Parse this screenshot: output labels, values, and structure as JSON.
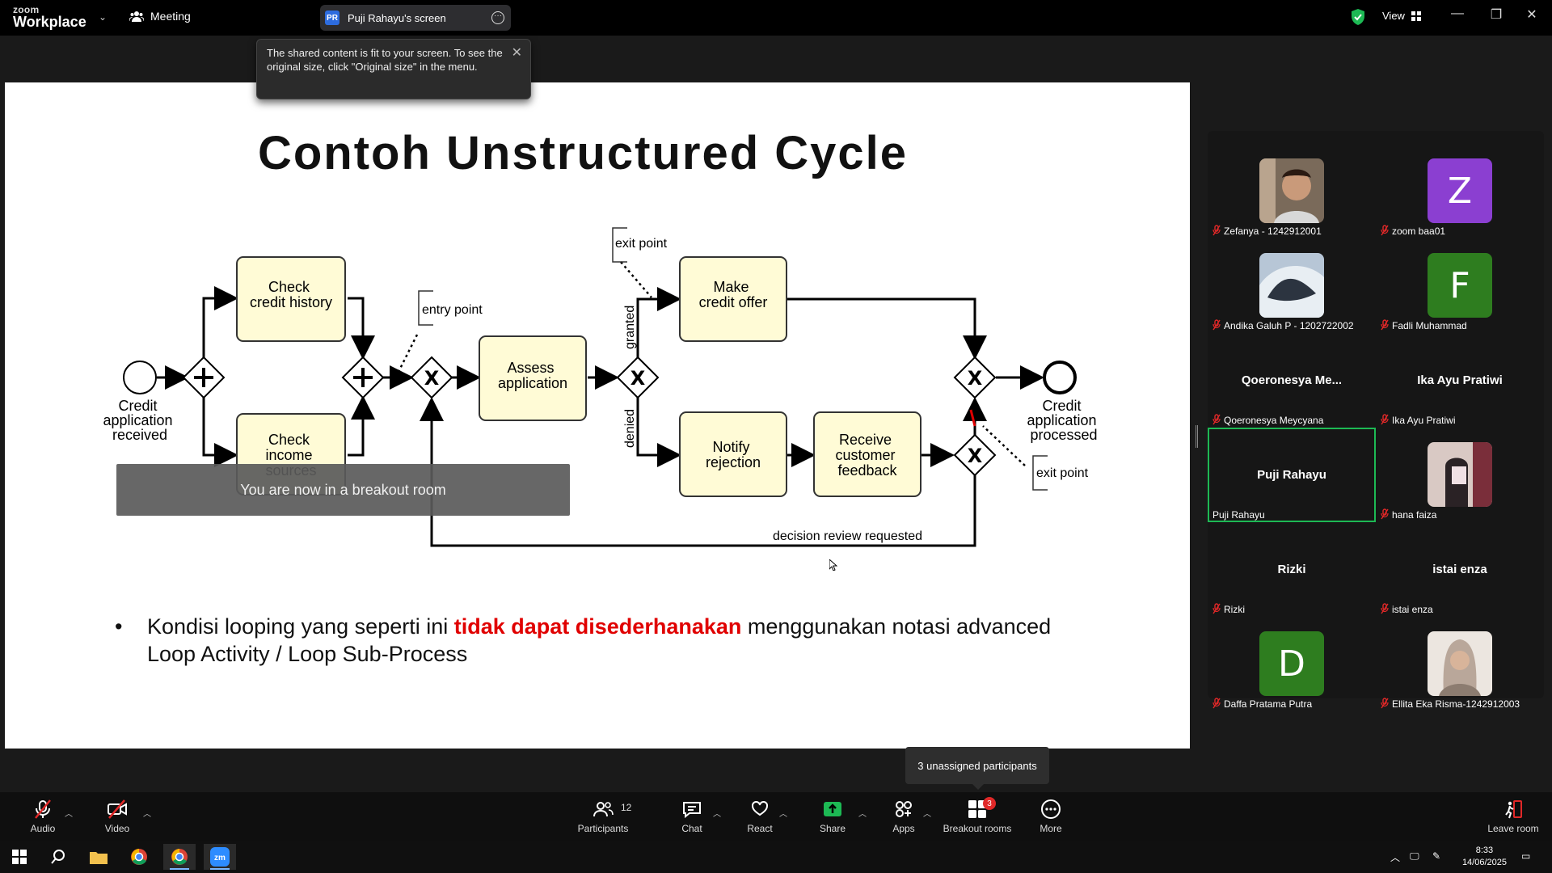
{
  "app": {
    "logo_line1": "zoom",
    "logo_line2": "Workplace",
    "meeting_label": "Meeting",
    "share_owner_initials": "PR",
    "share_label": "Puji Rahayu's screen",
    "view_label": "View"
  },
  "tooltip": {
    "text": "The shared content is fit to your screen. To see the original size, click \"Original size\" in the menu."
  },
  "slide": {
    "title": "Contoh Unstructured Cycle",
    "breakout_banner": "You are now in a breakout room",
    "bullet_prefix": "Kondisi looping yang seperti ini ",
    "bullet_highlight": "tidak dapat disederhanakan",
    "bullet_suffix": " menggunakan notasi advanced Loop Activity / Loop Sub-Process",
    "diagram": {
      "start_label": [
        "Credit",
        "application",
        "received"
      ],
      "check_credit": [
        "Check",
        "credit history"
      ],
      "check_income": [
        "Check",
        "income",
        "sources"
      ],
      "entry_point": "entry point",
      "assess": [
        "Assess",
        "application"
      ],
      "exit_point_top": "exit point",
      "granted": "granted",
      "denied": "denied",
      "make_offer": [
        "Make",
        "credit offer"
      ],
      "notify": [
        "Notify",
        "rejection"
      ],
      "feedback": [
        "Receive",
        "customer",
        "feedback"
      ],
      "end_label": [
        "Credit",
        "application",
        "processed"
      ],
      "exit_point_bottom": "exit point",
      "loop_label": "decision review requested"
    }
  },
  "gallery": {
    "tiles": [
      {
        "name": "Zefanya - 1242912001",
        "type": "photo",
        "muted": true
      },
      {
        "name": "zoom baa01",
        "type": "letter",
        "letter": "Z",
        "color": "#8b3fd1",
        "muted": true
      },
      {
        "name": "Andika Galuh P - 1202722002",
        "type": "photo",
        "muted": true
      },
      {
        "name": "Fadli Muhammad",
        "type": "letter",
        "letter": "F",
        "color": "#2e7d1f",
        "muted": true
      },
      {
        "name": "Qoeronesya Meycyana",
        "big": "Qoeronesya  Me...",
        "type": "text",
        "muted": true
      },
      {
        "name": "Ika Ayu Pratiwi",
        "big": "Ika Ayu Pratiwi",
        "type": "text",
        "muted": true
      },
      {
        "name": "Puji Rahayu",
        "big": "Puji Rahayu",
        "type": "text",
        "muted": false,
        "active": true
      },
      {
        "name": "hana faiza",
        "type": "photo",
        "muted": true
      },
      {
        "name": "Rizki",
        "big": "Rizki",
        "type": "text",
        "muted": true
      },
      {
        "name": "istai enza",
        "big": "istai enza",
        "type": "text",
        "muted": true
      },
      {
        "name": "Daffa Pratama Putra",
        "type": "letter",
        "letter": "D",
        "color": "#2e7d1f",
        "muted": true
      },
      {
        "name": "Ellita Eka Risma-1242912003",
        "type": "photo",
        "muted": true
      }
    ]
  },
  "hint": "3 unassigned participants",
  "toolbar": {
    "audio": "Audio",
    "video": "Video",
    "participants": "Participants",
    "participants_count": "12",
    "chat": "Chat",
    "react": "React",
    "share": "Share",
    "apps": "Apps",
    "breakout": "Breakout rooms",
    "breakout_badge": "3",
    "more": "More",
    "leave": "Leave room"
  },
  "taskbar": {
    "time": "8:33",
    "date": "14/06/2025"
  },
  "colors": {
    "accent_green": "#1db954",
    "share_green": "#1db954",
    "highlight_red": "#e00000",
    "task_fill": "#fffbd6"
  }
}
